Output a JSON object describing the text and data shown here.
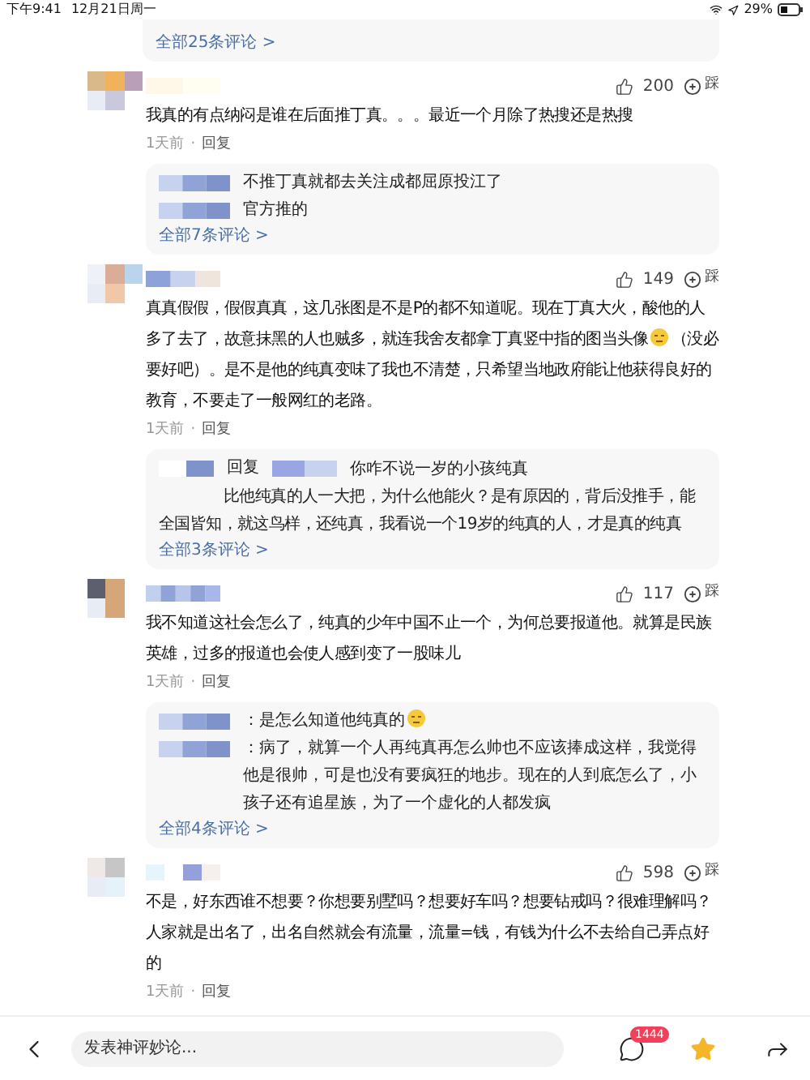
{
  "status_bar": {
    "time": "下午9:41",
    "date": "12月21日周一",
    "battery": "29%"
  },
  "top_more": "全部25条评论 >",
  "comments": [
    {
      "likes": "200",
      "dislike": "踩",
      "text": "我真的有点纳闷是谁在后面推丁真。。。最近一个月除了热搜还是热搜",
      "time": "1天前",
      "separator": "·",
      "reply_action": "回复",
      "replies": [
        {
          "kind": "blurred",
          "text": "不推丁真就都去关注成都屈原投江了"
        },
        {
          "kind": "blurred",
          "text": "官方推的"
        }
      ],
      "more": "全部7条评论 >"
    },
    {
      "likes": "149",
      "dislike": "踩",
      "text": "真真假假，假假真真，这几张图是不是P的都不知道呢。现在丁真大火，酸他的人多了去了，故意抹黑的人也贼多，就连我舍友都拿丁真竖中指的图当头像",
      "emoji": true,
      "text_after": "（没必要好吧）。是不是他的纯真变味了我也不清楚，只希望当地政府能让他获得良好的教育，不要走了一般网红的老路。",
      "time": "1天前",
      "separator": "·",
      "reply_action": "回复",
      "replies": [
        {
          "kind": "reply_to",
          "label": "回复",
          "text": "你咋不说一岁的小孩纯真",
          "continuation": "比他纯真的人一大把，为什么他能火？是有原因的，背后没推手，能全国皆知，就这鸟样，还纯真，我看说一个19岁的纯真的人，才是真的纯真"
        }
      ],
      "more": "全部3条评论 >"
    },
    {
      "likes": "117",
      "dislike": "踩",
      "text": "我不知道这社会怎么了，纯真的少年中国不止一个，为何总要报道他。就算是民族英雄，过多的报道也会使人感到变了一股味儿",
      "time": "1天前",
      "separator": "·",
      "reply_action": "回复",
      "replies": [
        {
          "kind": "blurred",
          "text": "：是怎么知道他纯真的",
          "emoji": true
        },
        {
          "kind": "blurred",
          "text": "：病了，就算一个人再纯真再怎么帅也不应该捧成这样，我觉得他是很帅，可是也没有要疯狂的地步。现在的人到底怎么了，小孩子还有追星族，为了一个虚化的人都发疯"
        }
      ],
      "more": "全部4条评论 >"
    },
    {
      "likes": "598",
      "dislike": "踩",
      "text": "不是，好东西谁不想要？你想要别墅吗？想要好车吗？想要钻戒吗？很难理解吗？人家就是出名了，出名自然就会有流量，流量=钱，有钱为什么不去给自己弄点好的",
      "time": "1天前",
      "separator": "·",
      "reply_action": "回复"
    }
  ],
  "bottom_bar": {
    "placeholder": "发表神评妙论...",
    "comment_count": "1444",
    "favorited": true
  }
}
